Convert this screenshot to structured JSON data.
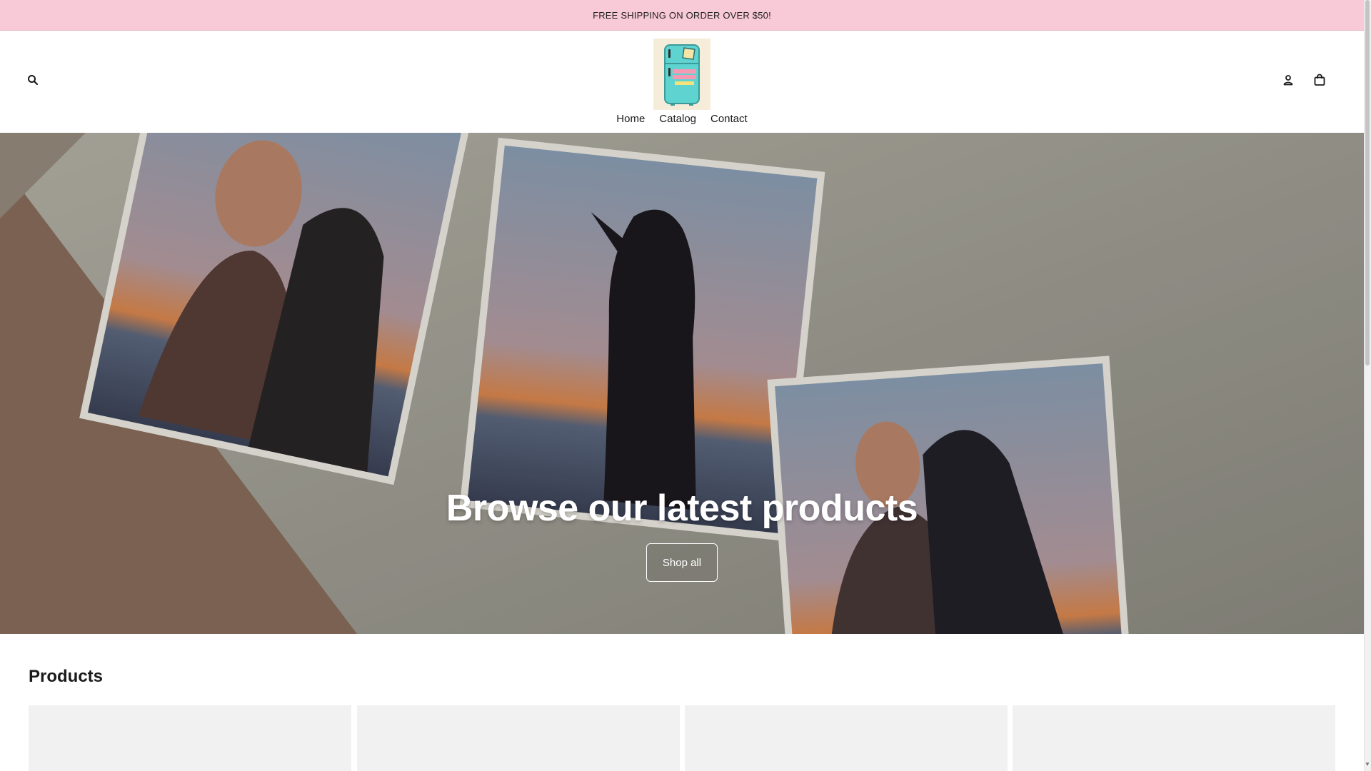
{
  "announcement": {
    "text": "FREE SHIPPING ON ORDER OVER $50!",
    "background": "#f8c9d6"
  },
  "header": {
    "search_icon": "search-icon",
    "account_icon": "account-icon",
    "cart_icon": "shopping-bag-icon",
    "logo_icon": "retro-fridge-logo"
  },
  "nav": {
    "items": [
      "Home",
      "Catalog",
      "Contact"
    ]
  },
  "hero": {
    "title": "Browse our latest products",
    "button_label": "Shop all"
  },
  "products": {
    "heading": "Products"
  },
  "colors": {
    "accent_pink": "#f8c9d6",
    "logo_fridge": "#5fd3d0",
    "text": "#1a1a1a"
  }
}
